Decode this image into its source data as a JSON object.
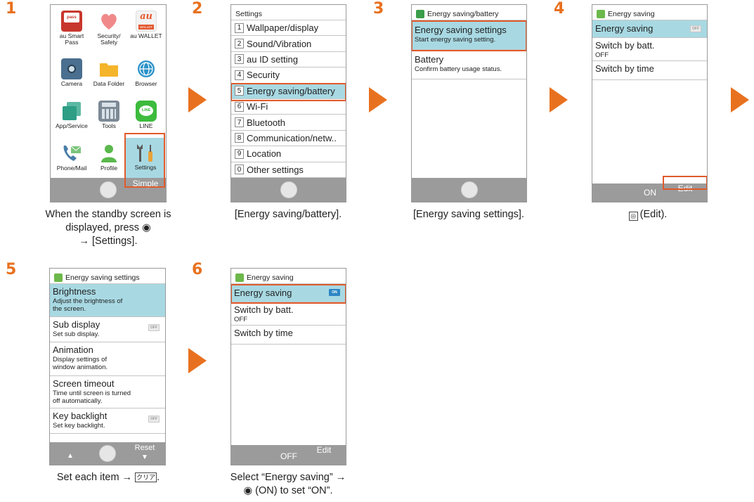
{
  "steps": [
    "1",
    "2",
    "3",
    "4",
    "5",
    "6"
  ],
  "screen1": {
    "apps": [
      {
        "label": "au Smart Pass",
        "icon": "au-smart-pass-icon"
      },
      {
        "label": "Security/ Safety",
        "icon": "heart-icon"
      },
      {
        "label": "au WALLET",
        "icon": "au-wallet-icon"
      },
      {
        "label": "Camera",
        "icon": "camera-icon"
      },
      {
        "label": "Data Folder",
        "icon": "folder-icon"
      },
      {
        "label": "Browser",
        "icon": "globe-icon"
      },
      {
        "label": "App/Service",
        "icon": "app-service-icon"
      },
      {
        "label": "Tools",
        "icon": "calculator-icon"
      },
      {
        "label": "LINE",
        "icon": "line-icon"
      },
      {
        "label": "Phone/Mail",
        "icon": "phone-mail-icon"
      },
      {
        "label": "Profile",
        "icon": "profile-icon"
      },
      {
        "label": "Settings",
        "icon": "settings-icon"
      }
    ],
    "pass_text": "pass",
    "au_text": "au",
    "wallet_text": "WALLET",
    "line_text": "LINE",
    "soft_right": "Simple",
    "caption_line1": "When the standby screen is",
    "caption_line2": "displayed, press ◉",
    "caption_line3": "→ [Settings]."
  },
  "screen2": {
    "title": "Settings",
    "items": [
      {
        "num": "1",
        "label": "Wallpaper/display"
      },
      {
        "num": "2",
        "label": "Sound/Vibration"
      },
      {
        "num": "3",
        "label": "au ID setting"
      },
      {
        "num": "4",
        "label": "Security"
      },
      {
        "num": "5",
        "label": "Energy saving/battery"
      },
      {
        "num": "6",
        "label": "Wi-Fi"
      },
      {
        "num": "7",
        "label": "Bluetooth"
      },
      {
        "num": "8",
        "label": "Communication/netw.."
      },
      {
        "num": "9",
        "label": "Location"
      },
      {
        "num": "0",
        "label": "Other settings"
      }
    ],
    "caption": "[Energy saving/battery]."
  },
  "screen3": {
    "title": "Energy saving/battery",
    "items": [
      {
        "title": "Energy saving settings",
        "sub": "Start energy saving setting."
      },
      {
        "title": "Battery",
        "sub": "Confirm battery usage status."
      }
    ],
    "caption": "[Energy saving settings]."
  },
  "screen4": {
    "title": "Energy saving",
    "items": [
      {
        "title": "Energy saving",
        "toggle": "OFF"
      },
      {
        "title": "Switch by batt.",
        "sub": "OFF"
      },
      {
        "title": "Switch by time"
      }
    ],
    "soft_center": "ON",
    "soft_right": "Edit",
    "caption": "(Edit)."
  },
  "screen5": {
    "title": "Energy saving settings",
    "items": [
      {
        "title": "Brightness",
        "sub1": "Adjust the brightness of",
        "sub2": "the screen."
      },
      {
        "title": "Sub display",
        "sub1": "Set sub display.",
        "toggle": "OFF"
      },
      {
        "title": "Animation",
        "sub1": "Display settings of",
        "sub2": "window animation."
      },
      {
        "title": "Screen timeout",
        "sub1": "Time until screen is turned",
        "sub2": "off automatically."
      },
      {
        "title": "Key backlight",
        "sub1": "Set key backlight.",
        "toggle": "OFF"
      }
    ],
    "soft_left": "▲",
    "soft_right_top": "Reset",
    "soft_right_bottom": "▼",
    "caption_text": "Set each item →",
    "caption_key": "クリア",
    "caption_end": "."
  },
  "screen6": {
    "title": "Energy saving",
    "items": [
      {
        "title": "Energy saving",
        "toggle": "ON"
      },
      {
        "title": "Switch by batt.",
        "sub": "OFF"
      },
      {
        "title": "Switch by time"
      }
    ],
    "soft_center": "OFF",
    "soft_right": "Edit",
    "caption_line1": "Select “Energy saving” →",
    "caption_line2": "◉ (ON) to set “ON”."
  }
}
